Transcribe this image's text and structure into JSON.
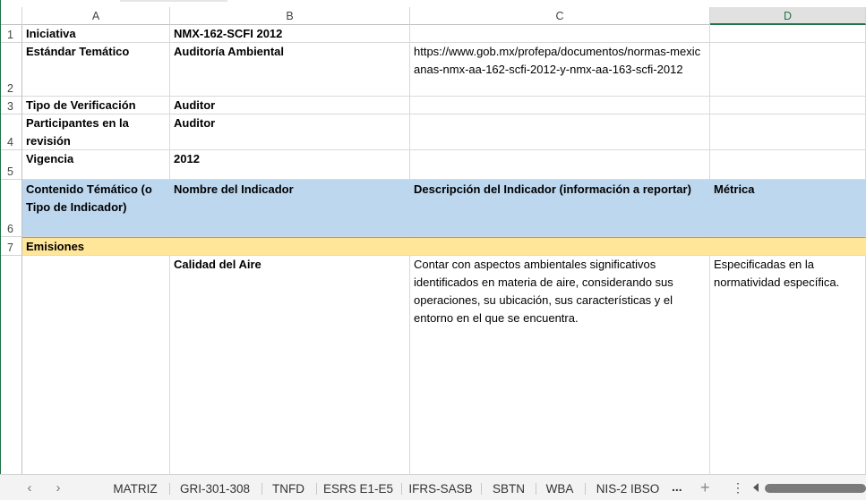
{
  "columns": [
    "A",
    "B",
    "C",
    "D"
  ],
  "rows": [
    "1",
    "2",
    "3",
    "4",
    "5",
    "6",
    "7"
  ],
  "cells": {
    "A1": "Iniciativa",
    "B1": "NMX-162-SCFI 2012",
    "A2": "Estándar Temático",
    "B2": "Auditoría Ambiental",
    "C2": "https://www.gob.mx/profepa/documentos/normas-mexicanas-nmx-aa-162-scfi-2012-y-nmx-aa-163-scfi-2012",
    "A3": "Tipo de Verificación",
    "B3": "Auditor",
    "A4": "Participantes en la revisión",
    "B4": "Auditor",
    "A5": "Vigencia",
    "B5": "2012",
    "A6": "Contenido Témático (o Tipo de Indicador)",
    "B6": "Nombre del Indicador",
    "C6": "Descripción del Indicador (información a reportar)",
    "D6": "Métrica",
    "A7": "Emisiones",
    "B8": "Calidad del Aire",
    "C8": "Contar con aspectos ambientales significativos identificados en materia de aire, considerando sus operaciones, su ubicación, sus características y el entorno en el que se encuentra.",
    "D8": "Especificadas en la normatividad específica."
  },
  "sheet_tabs": [
    "MATRIZ",
    "GRI-301-308",
    "TNFD",
    "ESRS E1-E5",
    "IFRS-SASB",
    "SBTN",
    "WBA",
    "NIS-2 IBSO"
  ],
  "tab_nav": {
    "prev": "‹",
    "next": "›",
    "more": "...",
    "add": "+",
    "options": "⋮"
  },
  "colors": {
    "header_fill": "#bdd7ee",
    "category_fill": "#ffe699",
    "accent": "#217346"
  }
}
